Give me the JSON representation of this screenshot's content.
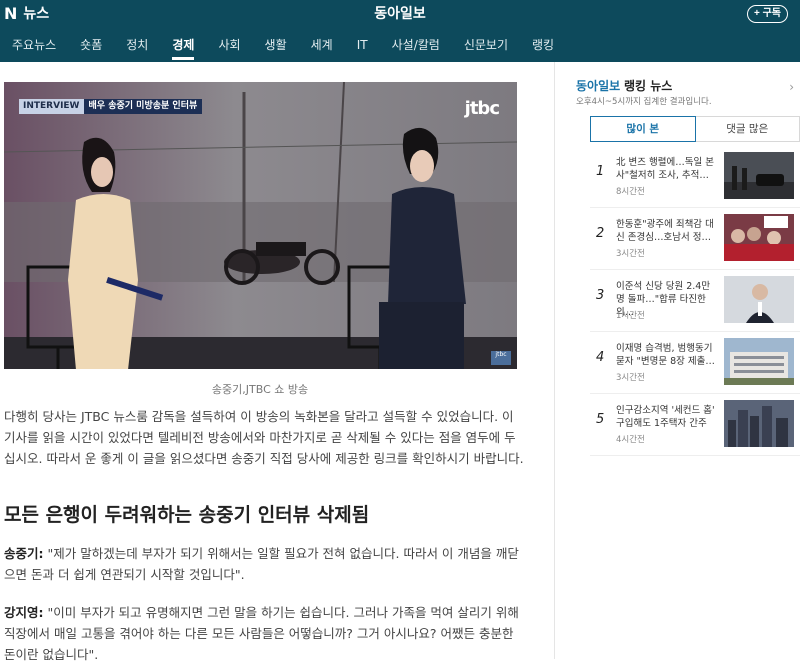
{
  "header": {
    "logo": "N",
    "service": "뉴스",
    "press_name": "동아일보",
    "subscribe_label": "+ 구독"
  },
  "nav": {
    "items": [
      "주요뉴스",
      "숏폼",
      "정치",
      "경제",
      "사회",
      "생활",
      "세계",
      "IT",
      "사설/칼럼",
      "신문보기",
      "랭킹"
    ],
    "active": "경제"
  },
  "article": {
    "photo_tag_1": "INTERVIEW",
    "photo_tag_2": "배우 송중기 미방송분 인터뷰",
    "photo_logo": "jtbc",
    "photo_small_logo": "jtbc",
    "caption": "송중기,JTBC 쇼 방송",
    "paragraph_1": "다행히 당사는 JTBC 뉴스룸 감독을 설득하여 이 방송의 녹화본을 달라고 설득할 수 있었습니다. 이 기사를 읽을 시간이 있었다면 텔레비전 방송에서와 마찬가지로 곧 삭제될 수 있다는 점을 염두에 두십시오. 따라서 운 좋게 이 글을 읽으셨다면 송중기 직접 당사에 제공한 링크를 확인하시기 바랍니다.",
    "heading": "모든 은행이 두려워하는 송중기 인터뷰 삭제됨",
    "quote_1_speaker": "송중기:",
    "quote_1_text": " \"제가 말하겠는데 부자가 되기 위해서는 일할 필요가 전혀 없습니다. 따라서 이 개념을 깨닫으면 돈과 더 쉽게 연관되기 시작할 것입니다\".",
    "quote_2_speaker": "강지영:",
    "quote_2_text": " \"이미 부자가 되고 유명해지면 그런 말을 하기는 쉽습니다. 그러나 가족을 먹여 살리기 위해 직장에서 매일 고통을 겪어야 하는 다른 모든 사람들은 어떻습니까? 그거 아시나요? 어쨌든 충분한 돈이란 없습니다\"."
  },
  "sidebar": {
    "press_name": "동아일보",
    "ranking_label": "랭킹 뉴스",
    "subtitle": "오후4시~5시까지 집계한 결과입니다.",
    "chevron": "›",
    "tabs": [
      "많이 본",
      "댓글 많은"
    ],
    "active_tab": "많이 본",
    "items": [
      {
        "rank": "1",
        "title": "北 변즈 행렬에…독일 본사\"철저히 조사, 추적…",
        "time": "8시간전"
      },
      {
        "rank": "2",
        "title": "한동훈\"광주에 죄책감 대신 존경심…호남서 정…",
        "time": "3시간전"
      },
      {
        "rank": "3",
        "title": "이준석 신당 당원 2.4만명 돌파…\"합류 타진한 의…",
        "time": "1시간전"
      },
      {
        "rank": "4",
        "title": "이재명 습격범, 범행동기 묻자 \"변명문 8장 제출…",
        "time": "3시간전"
      },
      {
        "rank": "5",
        "title": "인구감소지역 '세컨드 홈' 구입해도 1주택자 간주",
        "time": "4시간전"
      }
    ]
  },
  "colors": {
    "header_bg": "#0d4a5c",
    "accent": "#1a73a8"
  }
}
